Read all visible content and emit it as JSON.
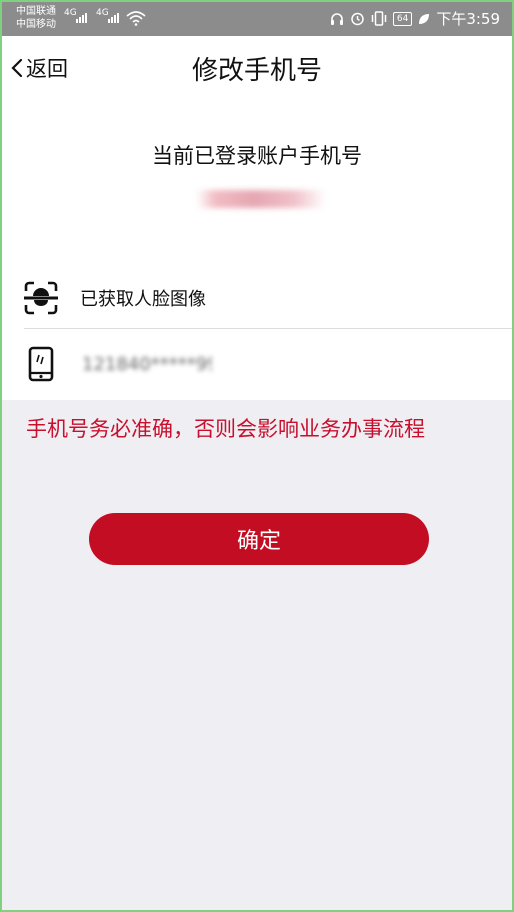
{
  "status_bar": {
    "carrier_1": "中国联通",
    "carrier_2": "中国移动",
    "network_1": "4G",
    "network_2": "4G",
    "battery": "64",
    "time": "下午3:59"
  },
  "navbar": {
    "back_label": "返回",
    "title": "修改手机号"
  },
  "account": {
    "label": "当前已登录账户手机号",
    "phone_masked": "***********"
  },
  "face_row": {
    "label": "已获取人脸图像"
  },
  "phone_row": {
    "value": "121840*****99",
    "placeholder": ""
  },
  "warning": "手机号务必准确，否则会影响业务办事流程",
  "confirm_label": "确定",
  "colors": {
    "accent": "#c30d23",
    "warning_text": "#c8102e",
    "background": "#efeef3",
    "status_bar": "#8c8c8c"
  }
}
